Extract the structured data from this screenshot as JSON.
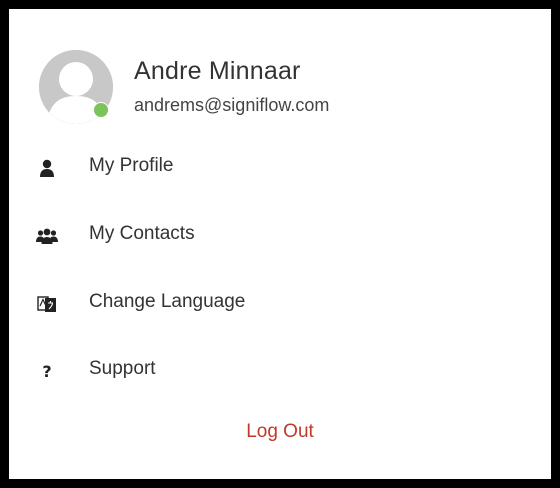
{
  "user": {
    "name": "Andre Minnaar",
    "email": "andrems@signiflow.com",
    "status_color": "#7cc35a"
  },
  "menu": {
    "items": [
      {
        "label": "My Profile",
        "icon": "user-icon"
      },
      {
        "label": "My Contacts",
        "icon": "users-icon"
      },
      {
        "label": "Change Language",
        "icon": "language-icon"
      },
      {
        "label": "Support",
        "icon": "question-icon",
        "glyph": "?"
      }
    ],
    "logout_label": "Log Out",
    "logout_color": "#c0392b"
  }
}
